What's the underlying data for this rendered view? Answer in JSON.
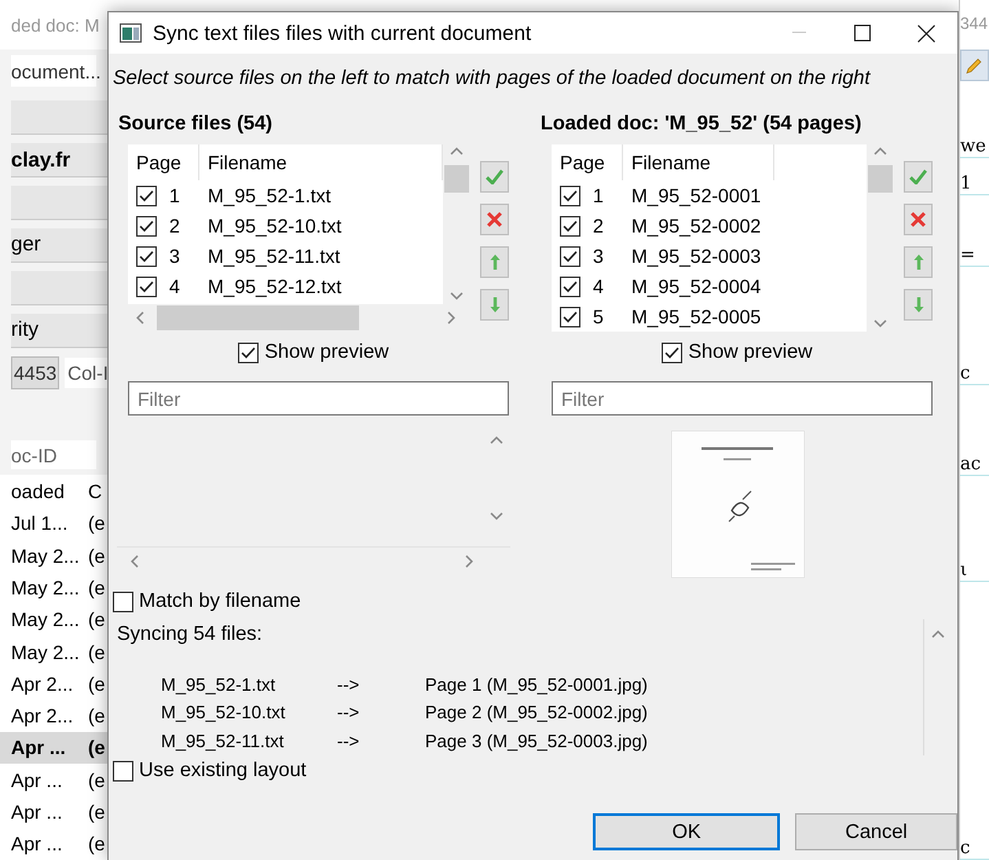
{
  "background_app": {
    "title_fragment": "ded doc: M",
    "document_field": "ocument...",
    "panel_rows": [
      {
        "kind": "blank",
        "text": ""
      },
      {
        "kind": "bold",
        "text": "clay.fr"
      },
      {
        "kind": "blank",
        "text": ""
      },
      {
        "kind": "label",
        "text": "ger"
      },
      {
        "kind": "blank",
        "text": ""
      },
      {
        "kind": "label",
        "text": "rity"
      }
    ],
    "id_chip": "4453",
    "col_field": "Col-I",
    "filter_field": "oc-ID",
    "table": {
      "columns": [
        "oaded",
        "C"
      ],
      "rows": [
        {
          "cells": [
            "Jul 1...",
            "(e"
          ],
          "selected": false
        },
        {
          "cells": [
            "May 2...",
            "(e"
          ],
          "selected": false
        },
        {
          "cells": [
            "May 2...",
            "(e"
          ],
          "selected": false
        },
        {
          "cells": [
            "May 2...",
            "(e"
          ],
          "selected": false
        },
        {
          "cells": [
            "May 2...",
            "(e"
          ],
          "selected": false
        },
        {
          "cells": [
            "Apr 2...",
            "(e"
          ],
          "selected": false
        },
        {
          "cells": [
            "Apr 2...",
            "(e"
          ],
          "selected": false
        },
        {
          "cells": [
            "Apr ...",
            "(e"
          ],
          "selected": true
        },
        {
          "cells": [
            "Apr ...",
            "(e"
          ],
          "selected": false
        },
        {
          "cells": [
            "Apr ...",
            "(e"
          ],
          "selected": false
        },
        {
          "cells": [
            "Apr ...",
            "(e"
          ],
          "selected": false
        }
      ]
    },
    "right_fragments": [
      "344",
      "we",
      "1",
      "=",
      "c",
      "ac",
      "ι",
      "c"
    ]
  },
  "dialog": {
    "title": "Sync text files files with current document",
    "instruction": "Select source files on the left to match with pages of the loaded document on the right",
    "panels": [
      {
        "heading": "Source files (54)",
        "columns": [
          "Page",
          "Filename"
        ],
        "rows": [
          {
            "page": "1",
            "filename": "M_95_52-1.txt",
            "checked": true
          },
          {
            "page": "2",
            "filename": "M_95_52-10.txt",
            "checked": true
          },
          {
            "page": "3",
            "filename": "M_95_52-11.txt",
            "checked": true
          },
          {
            "page": "4",
            "filename": "M_95_52-12.txt",
            "checked": true
          }
        ],
        "show_preview": {
          "label": "Show preview",
          "checked": true
        },
        "filter": {
          "placeholder": "Filter"
        },
        "preview": false
      },
      {
        "heading": "Loaded doc: 'M_95_52' (54 pages)",
        "columns": [
          "Page",
          "Filename"
        ],
        "rows": [
          {
            "page": "1",
            "filename": "M_95_52-0001",
            "checked": true
          },
          {
            "page": "2",
            "filename": "M_95_52-0002",
            "checked": true
          },
          {
            "page": "3",
            "filename": "M_95_52-0003",
            "checked": true
          },
          {
            "page": "4",
            "filename": "M_95_52-0004",
            "checked": true
          },
          {
            "page": "5",
            "filename": "M_95_52-0005",
            "checked": true
          }
        ],
        "show_preview": {
          "label": "Show preview",
          "checked": true
        },
        "filter": {
          "placeholder": "Filter"
        },
        "preview": true
      }
    ],
    "match_by_filename": {
      "label": "Match by filename",
      "checked": false
    },
    "sync_label": "Syncing 54 files:",
    "sync_lines": [
      {
        "file": "M_95_52-1.txt",
        "arrow": "-->",
        "page": "Page 1 (M_95_52-0001.jpg)"
      },
      {
        "file": "M_95_52-10.txt",
        "arrow": "-->",
        "page": "Page 2 (M_95_52-0002.jpg)"
      },
      {
        "file": "M_95_52-11.txt",
        "arrow": "-->",
        "page": "Page 3 (M_95_52-0003.jpg)"
      }
    ],
    "use_existing_layout": {
      "label": "Use existing layout",
      "checked": false
    },
    "buttons": [
      {
        "label": "OK",
        "default": true
      },
      {
        "label": "Cancel",
        "default": false
      }
    ]
  }
}
